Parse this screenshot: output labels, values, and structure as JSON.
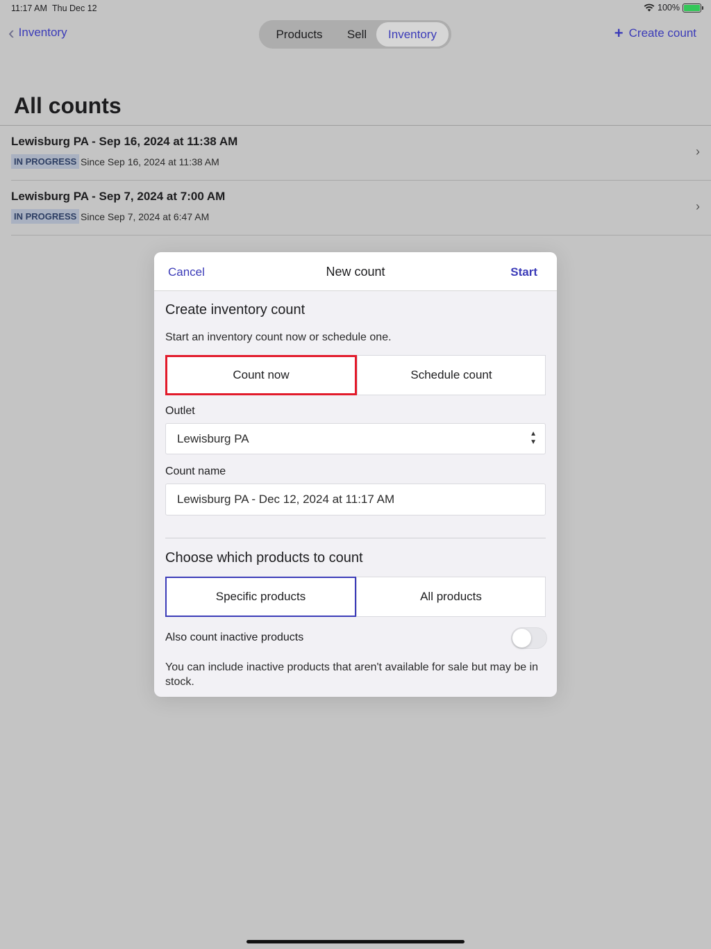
{
  "status_bar": {
    "time": "11:17 AM",
    "date": "Thu Dec 12",
    "battery": "100%"
  },
  "nav": {
    "back_label": "Inventory",
    "tabs": [
      {
        "label": "Products",
        "selected": false
      },
      {
        "label": "Sell",
        "selected": false
      },
      {
        "label": "Inventory",
        "selected": true
      }
    ],
    "create_label": "Create count"
  },
  "page": {
    "title": "All counts",
    "counts": [
      {
        "title": "Lewisburg PA - Sep 16, 2024 at 11:38 AM",
        "status": "IN PROGRESS",
        "since": "Since Sep 16, 2024 at 11:38 AM"
      },
      {
        "title": "Lewisburg PA - Sep 7, 2024 at 7:00 AM",
        "status": "IN PROGRESS",
        "since": "Since Sep 7, 2024 at 6:47 AM"
      }
    ]
  },
  "modal": {
    "cancel_label": "Cancel",
    "title": "New count",
    "start_label": "Start",
    "section1_title": "Create inventory count",
    "section1_desc": "Start an inventory count now or schedule one.",
    "mode_options": [
      "Count now",
      "Schedule count"
    ],
    "outlet_label": "Outlet",
    "outlet_value": "Lewisburg PA",
    "count_name_label": "Count name",
    "count_name_value": "Lewisburg PA - Dec 12, 2024 at 11:17 AM",
    "section2_title": "Choose which products to count",
    "product_options": [
      "Specific products",
      "All products"
    ],
    "inactive_label": "Also count inactive products",
    "inactive_on": false,
    "inactive_desc": "You can include inactive products that aren't available for sale but may be in stock."
  },
  "colors": {
    "accent": "#3b3bb8",
    "highlight": "#e21a2a",
    "badge_bg": "#a9b1c1"
  }
}
